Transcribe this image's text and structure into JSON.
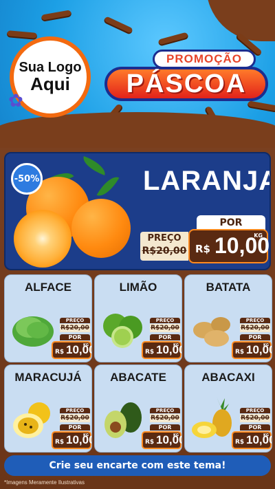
{
  "header": {
    "logo_line1": "Sua Logo",
    "logo_line2": "Aqui",
    "promo_label": "PROMOÇÃO",
    "promo_title": "PÁSCOA"
  },
  "featured": {
    "discount_badge": "-50%",
    "name": "LARANJA",
    "old_price_label": "PREÇO",
    "old_price": "R$20,00",
    "new_price_label": "POR",
    "currency": "R$",
    "new_price": "10,00",
    "unit": "KG"
  },
  "products": [
    {
      "name": "ALFACE",
      "old_label": "PREÇO",
      "old_price": "R$20,00",
      "new_label": "POR",
      "currency": "R$",
      "new_price": "10,00",
      "unit": "KG",
      "icon": "lettuce-icon"
    },
    {
      "name": "LIMÃO",
      "old_label": "PREÇO",
      "old_price": "R$20,00",
      "new_label": "POR",
      "currency": "R$",
      "new_price": "10,00",
      "unit": "KG",
      "icon": "lime-icon"
    },
    {
      "name": "BATATA",
      "old_label": "PREÇO",
      "old_price": "R$20,00",
      "new_label": "POR",
      "currency": "R$",
      "new_price": "10,00",
      "unit": "KG",
      "icon": "potato-icon"
    },
    {
      "name": "MARACUJÁ",
      "old_label": "PREÇO",
      "old_price": "R$20,00",
      "new_label": "POR",
      "currency": "R$",
      "new_price": "10,00",
      "unit": "KG",
      "icon": "passion-fruit-icon"
    },
    {
      "name": "ABACATE",
      "old_label": "PREÇO",
      "old_price": "R$20,00",
      "new_label": "POR",
      "currency": "R$",
      "new_price": "10,00",
      "unit": "KG",
      "icon": "avocado-icon"
    },
    {
      "name": "ABACAXI",
      "old_label": "PREÇO",
      "old_price": "R$20,00",
      "new_label": "POR",
      "currency": "R$",
      "new_price": "10,00",
      "unit": "KG",
      "icon": "pineapple-icon"
    }
  ],
  "cta": "Crie seu encarte com este tema!",
  "footnote": "*Imagens Meramente Ilustrativas",
  "colors": {
    "accent_orange": "#ff8a1e",
    "chocolate": "#5a2a12",
    "featured_blue": "#1c3d8a",
    "sky_blue": "#1aa4e8"
  }
}
